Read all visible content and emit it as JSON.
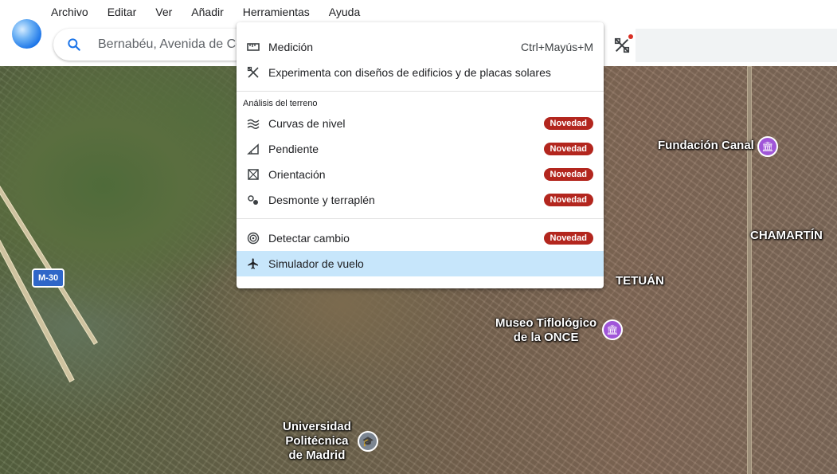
{
  "menubar": {
    "items": [
      "Archivo",
      "Editar",
      "Ver",
      "Añadir",
      "Herramientas",
      "Ayuda"
    ]
  },
  "search": {
    "value": "Bernabéu, Avenida de Co"
  },
  "tools_menu": {
    "items": [
      {
        "label": "Medición",
        "shortcut": "Ctrl+Mayús+M",
        "icon": "ruler-icon"
      },
      {
        "label": "Experimenta con diseños de edificios y de placas solares",
        "icon": "design-tools-icon"
      }
    ],
    "terrain_section": {
      "title": "Análisis del terreno",
      "items": [
        {
          "label": "Curvas de nivel",
          "badge": "Novedad",
          "icon": "contour-icon"
        },
        {
          "label": "Pendiente",
          "badge": "Novedad",
          "icon": "slope-icon"
        },
        {
          "label": "Orientación",
          "badge": "Novedad",
          "icon": "aspect-icon"
        },
        {
          "label": "Desmonte y terraplén",
          "badge": "Novedad",
          "icon": "cut-fill-icon"
        }
      ]
    },
    "other_items": [
      {
        "label": "Detectar cambio",
        "badge": "Novedad",
        "icon": "change-detect-icon"
      },
      {
        "label": "Simulador de vuelo",
        "icon": "airplane-icon"
      }
    ]
  },
  "map": {
    "labels": {
      "fundacion": "Fundación Canal",
      "chamartin": "CHAMARTÍN",
      "tetuan": "TETUÁN",
      "museo_line1": "Museo Tiflológico",
      "museo_line2": "de la ONCE",
      "upm_line1": "Universidad",
      "upm_line2": "Politécnica",
      "upm_line3": "de Madrid"
    },
    "road_shield": "M-30"
  },
  "colors": {
    "badge": "#b3261e",
    "active_item": "#c7e6fb",
    "museum_poi": "#a056d8"
  }
}
